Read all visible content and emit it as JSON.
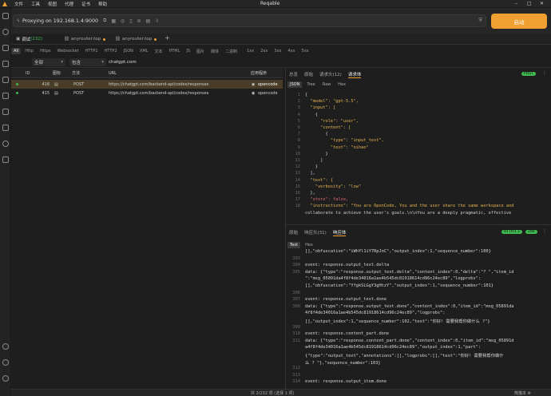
{
  "menu": [
    "文件",
    "工具",
    "视图",
    "代理",
    "证书",
    "帮助"
  ],
  "app_title": "Reqable",
  "proxy_text": "Proxying on 192.168.1.4:9000",
  "start_label": "启动",
  "tabs": [
    {
      "label": "调试",
      "count": "(232)"
    },
    {
      "label": "anyrouter.top"
    },
    {
      "label": "anyrouter.top"
    }
  ],
  "filter_chips": [
    "All",
    "Http",
    "Https",
    "Websocket",
    "HTTP1",
    "HTTP2",
    "JSON",
    "XML",
    "文本",
    "HTML",
    "JS",
    "图片",
    "媒体",
    "二进制",
    "1xx",
    "2xx",
    "3xx",
    "4xx",
    "5xx"
  ],
  "search": {
    "scope": "全部",
    "mode": "包含",
    "query": "chatgpt.com"
  },
  "table": {
    "headers": {
      "id": "ID",
      "icon": "图标",
      "method": "方法",
      "url": "URL",
      "app": "应用程序"
    },
    "rows": [
      {
        "id": "416",
        "method": "POST",
        "url": "https://chatgpt.com/backend-api/codex/responses",
        "app": "opencode"
      },
      {
        "id": "415",
        "method": "POST",
        "url": "https://chatgpt.com/backend-api/codex/responses",
        "app": "opencode"
      }
    ]
  },
  "req_tabs": [
    "总览",
    "原始",
    "请求头(12)",
    "请求体"
  ],
  "req_badge": "POST",
  "req_views": [
    "JSON",
    "Tree",
    "Raw",
    "Hex"
  ],
  "req_code": [
    {
      "n": "1",
      "t": "{"
    },
    {
      "n": "2",
      "t": "  \"model\": \"gpt-5.5\","
    },
    {
      "n": "3",
      "t": "  \"input\": ["
    },
    {
      "n": "4",
      "t": "    {"
    },
    {
      "n": "5",
      "t": "      \"role\": \"user\","
    },
    {
      "n": "6",
      "t": "      \"content\": ["
    },
    {
      "n": "7",
      "t": "        {"
    },
    {
      "n": "8",
      "t": "          \"type\": \"input_text\","
    },
    {
      "n": "9",
      "t": "          \"text\": \"nihao\""
    },
    {
      "n": "10",
      "t": "        }"
    },
    {
      "n": "11",
      "t": "      ]"
    },
    {
      "n": "12",
      "t": "    }"
    },
    {
      "n": "13",
      "t": "  ],"
    },
    {
      "n": "14",
      "t": "  \"text\": {"
    },
    {
      "n": "15",
      "t": "    \"verbosity\": \"low\""
    },
    {
      "n": "16",
      "t": "  },"
    },
    {
      "n": "17",
      "t": "  \"store\": false,"
    },
    {
      "n": "18",
      "t": "  \"instructions\": \"You are OpenCode, You and the user share the same workspace and"
    },
    {
      "n": "",
      "t": "collaborate to achieve the user's goals.\\n\\nYou are a deeply pragmatic, effective"
    }
  ],
  "resp_tabs": [
    "原始",
    "响应头(31)",
    "响应体"
  ],
  "resp_badges": [
    "HTTP/1.1",
    "200"
  ],
  "resp_views": [
    "Text",
    "Hex"
  ],
  "resp_lines": [
    {
      "n": "",
      "t": "[],\"obfuscation\":\"iWhYl1iY7RpJnC\",\"output_index\":1,\"sequence_number\":100}"
    },
    {
      "n": "303",
      "t": ""
    },
    {
      "n": "304",
      "t": "event: response.output_text.delta"
    },
    {
      "n": "305",
      "t": "data: {\"type\":\"response.output_text.delta\",\"content_index\":0,\"delta\":\"? \",\"item_id"
    },
    {
      "n": "",
      "t": "\":\"msg_05891da4f8f4de34016a1ae4b545dc81918614cd96c24ec89\",\"logprobs\":"
    },
    {
      "n": "",
      "t": "[],\"obfuscation\":\"YfgkSLGgY3gHtzY\",\"output_index\":1,\"sequence_number\":101}"
    },
    {
      "n": "306",
      "t": ""
    },
    {
      "n": "307",
      "t": "event: response.output_text.done"
    },
    {
      "n": "308",
      "t": "data: {\"type\":\"response.output_text.done\",\"content_index\":0,\"item_id\":\"msg_05891da"
    },
    {
      "n": "",
      "t": "4f8f4de34016a1ae4b545dc81918614cd96c24ec89\",\"logprobs\":"
    },
    {
      "n": "",
      "t": "[],\"output_index\":1,\"sequence_number\":102,\"text\":\"你好! 需要我帮你做什么 ?\"}"
    },
    {
      "n": "309",
      "t": ""
    },
    {
      "n": "310",
      "t": "event: response.content_part.done"
    },
    {
      "n": "311",
      "t": "data: {\"type\":\"response.content_part.done\",\"content_index\":0,\"item_id\":\"msg_05891d"
    },
    {
      "n": "",
      "t": "a4f8f4de34016a1ae4b545dc81918614cd96c24ec89\",\"output_index\":1,\"part\":"
    },
    {
      "n": "",
      "t": "{\"type\":\"output_text\",\"annotations\":[],\"logprobs\":[],\"text\":\"你好! 需要我帮你做什"
    },
    {
      "n": "",
      "t": "么 ? \"},\"sequence_number\":103}"
    },
    {
      "n": "312",
      "t": ""
    },
    {
      "n": "313",
      "t": ""
    },
    {
      "n": "314",
      "t": "event: response.output_item.done"
    }
  ],
  "status": {
    "summary": "共 2/232 项 (选择 1 项)",
    "right": "熊猫本 ⚙"
  }
}
